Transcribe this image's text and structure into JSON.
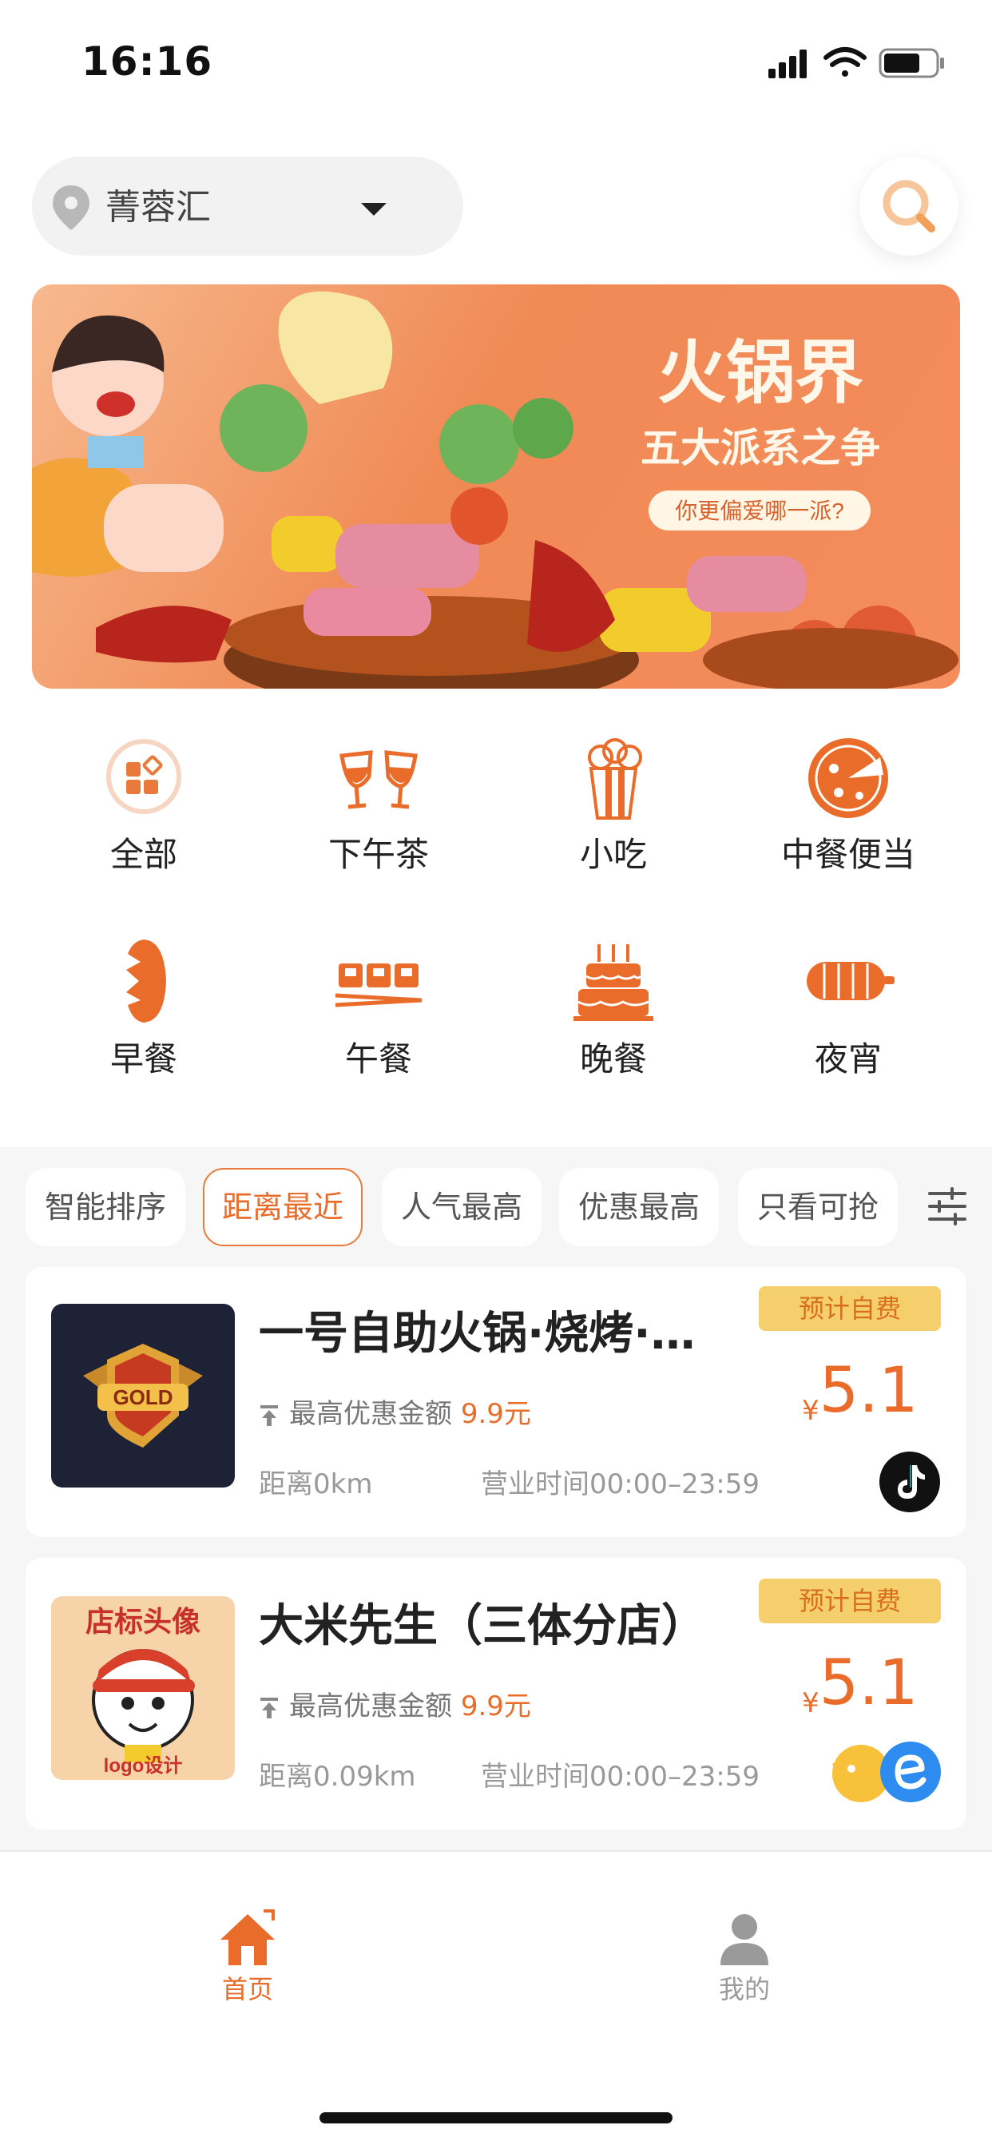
{
  "status_bar": {
    "time": "16:16"
  },
  "header": {
    "location": "菁蓉汇"
  },
  "banner": {
    "title": "火锅界",
    "subtitle": "五大派系之争",
    "tagline": "你更偏爱哪一派?"
  },
  "categories": [
    {
      "label": "全部",
      "icon": "all-icon"
    },
    {
      "label": "下午茶",
      "icon": "wine-glasses-icon"
    },
    {
      "label": "小吃",
      "icon": "popcorn-icon"
    },
    {
      "label": "中餐便当",
      "icon": "pizza-icon"
    },
    {
      "label": "早餐",
      "icon": "bread-icon"
    },
    {
      "label": "午餐",
      "icon": "sushi-icon"
    },
    {
      "label": "晚餐",
      "icon": "cake-icon"
    },
    {
      "label": "夜宵",
      "icon": "skewer-icon"
    }
  ],
  "sort_chips": [
    {
      "label": "智能排序",
      "active": false
    },
    {
      "label": "距离最近",
      "active": true
    },
    {
      "label": "人气最高",
      "active": false
    },
    {
      "label": "优惠最高",
      "active": false
    },
    {
      "label": "只看可抢",
      "active": false
    }
  ],
  "stores": [
    {
      "name": "一号自助火锅·烧烤·…",
      "discount_label": "最高优惠金额",
      "discount_value": "9.9",
      "discount_unit": "元",
      "distance": "距离0km",
      "hours": "营业时间00:00–23:59",
      "badge": "预计自费",
      "currency": "¥",
      "price": "5.1",
      "thumb_text": "GOLD",
      "platform_icons": [
        "tiktok-icon"
      ]
    },
    {
      "name": "大米先生（三体分店）",
      "discount_label": "最高优惠金额",
      "discount_value": "9.9",
      "discount_unit": "元",
      "distance": "距离0.09km",
      "hours": "营业时间00:00–23:59",
      "badge": "预计自费",
      "currency": "¥",
      "price": "5.1",
      "thumb_text": "店标头像",
      "thumb_text2": "logo设计",
      "platform_icons": [
        "meituan-icon",
        "eleme-icon"
      ]
    }
  ],
  "tabbar": {
    "tabs": [
      {
        "label": "首页",
        "active": true,
        "icon": "home-icon"
      },
      {
        "label": "我的",
        "active": false,
        "icon": "user-icon"
      }
    ]
  },
  "colors": {
    "accent": "#ea6c2a",
    "badge_bg": "#f6cf6d",
    "inactive": "#9a9a9a"
  }
}
